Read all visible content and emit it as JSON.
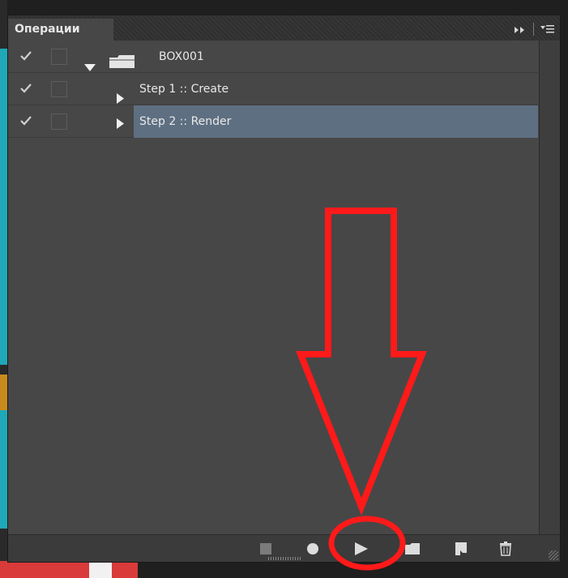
{
  "panel": {
    "tab_title": "Операции"
  },
  "actions": [
    {
      "label": "BOX001",
      "kind": "set",
      "checked": true,
      "expanded": true
    },
    {
      "label": "Step 1 :: Create",
      "kind": "action",
      "checked": true,
      "expanded": false
    },
    {
      "label": "Step 2 :: Render",
      "kind": "action",
      "checked": true,
      "expanded": false,
      "selected": true
    }
  ],
  "toolbar": {
    "buttons": [
      "stop-icon",
      "record-icon",
      "play-icon",
      "new-set-icon",
      "new-action-icon",
      "trash-icon"
    ]
  },
  "colors": {
    "panel_bg": "#474747",
    "selection": "#5e6f82",
    "annotation_red": "#ff1a1a"
  }
}
